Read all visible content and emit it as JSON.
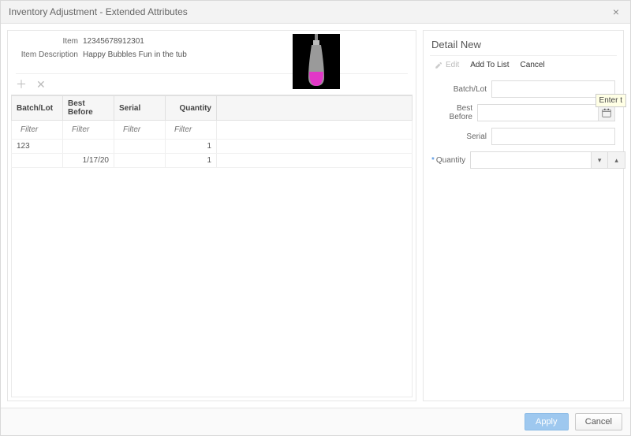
{
  "window": {
    "title": "Inventory Adjustment - Extended Attributes"
  },
  "item": {
    "label_item": "Item",
    "number": "12345678912301",
    "label_desc": "Item Description",
    "description": "Happy Bubbles Fun in the tub"
  },
  "grid": {
    "filter_placeholder": "Filter",
    "headers": {
      "batch": "Batch/Lot",
      "best_before": "Best Before",
      "serial": "Serial",
      "quantity": "Quantity"
    },
    "rows": [
      {
        "batch": "123",
        "best_before": "",
        "serial": "",
        "quantity": "1"
      },
      {
        "batch": "",
        "best_before": "1/17/20",
        "serial": "",
        "quantity": "1"
      }
    ]
  },
  "detail": {
    "title": "Detail New",
    "actions": {
      "edit": "Edit",
      "add": "Add To List",
      "cancel": "Cancel"
    },
    "labels": {
      "batch": "Batch/Lot",
      "best_before": "Best Before",
      "serial": "Serial",
      "quantity": "Quantity"
    },
    "values": {
      "batch": "",
      "best_before": "",
      "serial": "",
      "quantity": ""
    },
    "tooltip": "Enter t"
  },
  "footer": {
    "apply": "Apply",
    "cancel": "Cancel"
  }
}
